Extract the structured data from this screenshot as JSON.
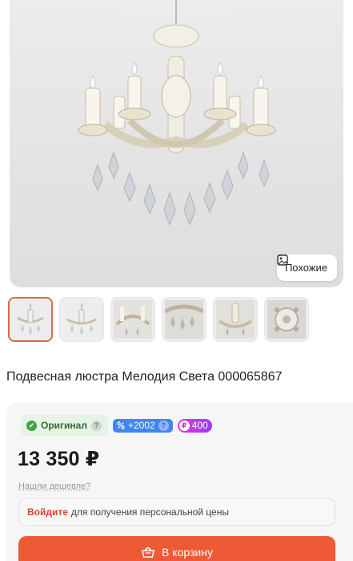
{
  "product": {
    "title": "Подвесная люстра Мелодия Света 000065867",
    "price": "13 350 ₽",
    "cheaper_link": "Нашли дешевле?"
  },
  "gallery": {
    "similar_label": "Похожие",
    "thumbnails": [
      {
        "icon": "chandelier-front"
      },
      {
        "icon": "chandelier-side"
      },
      {
        "icon": "chandelier-detail-arms"
      },
      {
        "icon": "chandelier-detail-crystals"
      },
      {
        "icon": "chandelier-detail-center"
      },
      {
        "icon": "chandelier-detail-bottom"
      }
    ]
  },
  "badges": {
    "original_label": "Оригинал",
    "original_help": "?",
    "bonus_label": "+2002",
    "bonus_help": "?",
    "points_label": "400",
    "points_glyph": "₽"
  },
  "login_prompt": {
    "link": "Войдите",
    "text": "для получения персональной цены"
  },
  "cart": {
    "button_label": "В корзину"
  },
  "colors": {
    "accent": "#ee5a36",
    "original_bg": "#e6f3e6",
    "bonus_bg": "#3f86f2",
    "points_gradient": "#e23ad7"
  }
}
